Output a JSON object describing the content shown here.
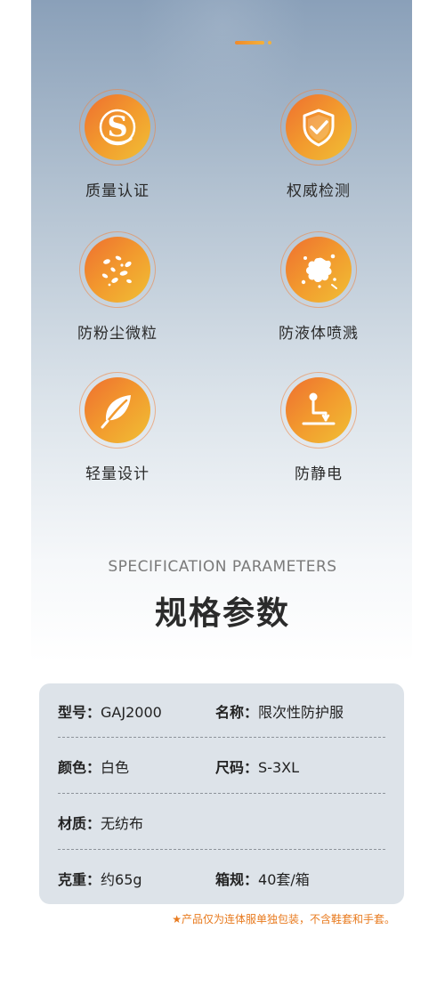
{
  "features": [
    {
      "icon": "quality-certification-icon",
      "label": "质量认证"
    },
    {
      "icon": "shield-check-icon",
      "label": "权威检测"
    },
    {
      "icon": "dust-particles-icon",
      "label": "防粉尘微粒"
    },
    {
      "icon": "liquid-splash-icon",
      "label": "防液体喷溅"
    },
    {
      "icon": "leaf-icon",
      "label": "轻量设计"
    },
    {
      "icon": "lightning-ground-icon",
      "label": "防静电"
    }
  ],
  "spec": {
    "title_en": "SPECIFICATION PARAMETERS",
    "title_zh": "规格参数",
    "rows": [
      [
        {
          "key": "型号",
          "value": "GAJ2000"
        },
        {
          "key": "名称",
          "value": "限次性防护服"
        }
      ],
      [
        {
          "key": "颜色",
          "value": "白色"
        },
        {
          "key": "尺码",
          "value": "S-3XL"
        }
      ],
      [
        {
          "key": "材质",
          "value": "无纺布"
        }
      ],
      [
        {
          "key": "克重",
          "value": "约65g"
        },
        {
          "key": "箱规",
          "value": "40套/箱"
        }
      ]
    ]
  },
  "footnote": "★产品仅为连体服单独包装，不含鞋套和手套。",
  "colors": {
    "accent_start": "#ee6f30",
    "accent_end": "#f0bf35",
    "footnote": "#e87a1e"
  }
}
